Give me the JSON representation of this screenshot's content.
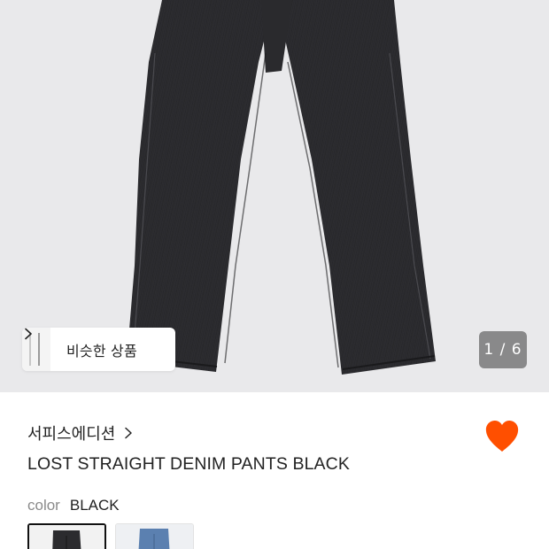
{
  "gallery": {
    "counter": "1 / 6",
    "similar_label": "비슷한 상품"
  },
  "product": {
    "brand": "서피스에디션",
    "name": "LOST STRAIGHT DENIM PANTS BLACK",
    "liked": true,
    "color_label": "color",
    "color_value": "BLACK"
  },
  "options": [
    {
      "color": "black denim",
      "selected": true
    },
    {
      "color": "blue denim",
      "selected": false
    }
  ],
  "colors": {
    "heart": "#ff4f00",
    "hero_bg": "#e9e9eb",
    "denim_black": "#2b2b2e",
    "denim_blue": "#5b80b0"
  }
}
